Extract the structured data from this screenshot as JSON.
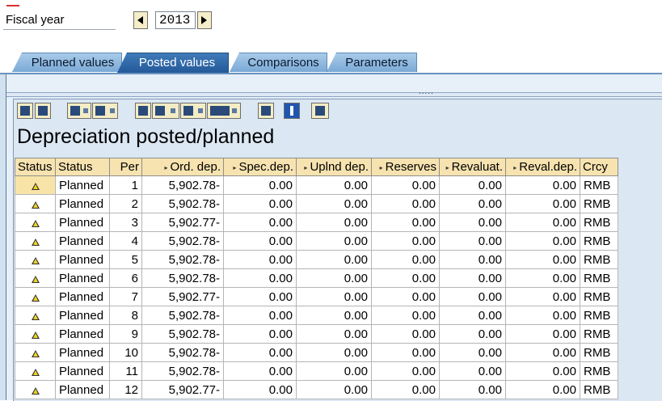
{
  "fiscal_year": {
    "label": "Fiscal year",
    "value": "2013"
  },
  "tabs": [
    {
      "label": "Planned values"
    },
    {
      "label": "Posted values"
    },
    {
      "label": "Comparisons"
    },
    {
      "label": "Parameters"
    }
  ],
  "report": {
    "title": "Depreciation posted/planned",
    "columns": [
      "Status",
      "Status",
      "Per",
      "Ord. dep.",
      "Spec.dep.",
      "Uplnd dep.",
      "Reserves",
      "Revaluat.",
      "Reval.dep.",
      "Crcy"
    ],
    "rows": [
      {
        "status_text": "Planned",
        "per": "1",
        "ord": "5,902.78-",
        "spec": "0.00",
        "uplnd": "0.00",
        "reserves": "0.00",
        "revaluat": "0.00",
        "revaldep": "0.00",
        "crcy": "RMB"
      },
      {
        "status_text": "Planned",
        "per": "2",
        "ord": "5,902.78-",
        "spec": "0.00",
        "uplnd": "0.00",
        "reserves": "0.00",
        "revaluat": "0.00",
        "revaldep": "0.00",
        "crcy": "RMB"
      },
      {
        "status_text": "Planned",
        "per": "3",
        "ord": "5,902.77-",
        "spec": "0.00",
        "uplnd": "0.00",
        "reserves": "0.00",
        "revaluat": "0.00",
        "revaldep": "0.00",
        "crcy": "RMB"
      },
      {
        "status_text": "Planned",
        "per": "4",
        "ord": "5,902.78-",
        "spec": "0.00",
        "uplnd": "0.00",
        "reserves": "0.00",
        "revaluat": "0.00",
        "revaldep": "0.00",
        "crcy": "RMB"
      },
      {
        "status_text": "Planned",
        "per": "5",
        "ord": "5,902.78-",
        "spec": "0.00",
        "uplnd": "0.00",
        "reserves": "0.00",
        "revaluat": "0.00",
        "revaldep": "0.00",
        "crcy": "RMB"
      },
      {
        "status_text": "Planned",
        "per": "6",
        "ord": "5,902.78-",
        "spec": "0.00",
        "uplnd": "0.00",
        "reserves": "0.00",
        "revaluat": "0.00",
        "revaldep": "0.00",
        "crcy": "RMB"
      },
      {
        "status_text": "Planned",
        "per": "7",
        "ord": "5,902.77-",
        "spec": "0.00",
        "uplnd": "0.00",
        "reserves": "0.00",
        "revaluat": "0.00",
        "revaldep": "0.00",
        "crcy": "RMB"
      },
      {
        "status_text": "Planned",
        "per": "8",
        "ord": "5,902.78-",
        "spec": "0.00",
        "uplnd": "0.00",
        "reserves": "0.00",
        "revaluat": "0.00",
        "revaldep": "0.00",
        "crcy": "RMB"
      },
      {
        "status_text": "Planned",
        "per": "9",
        "ord": "5,902.78-",
        "spec": "0.00",
        "uplnd": "0.00",
        "reserves": "0.00",
        "revaluat": "0.00",
        "revaldep": "0.00",
        "crcy": "RMB"
      },
      {
        "status_text": "Planned",
        "per": "10",
        "ord": "5,902.78-",
        "spec": "0.00",
        "uplnd": "0.00",
        "reserves": "0.00",
        "revaluat": "0.00",
        "revaldep": "0.00",
        "crcy": "RMB"
      },
      {
        "status_text": "Planned",
        "per": "11",
        "ord": "5,902.78-",
        "spec": "0.00",
        "uplnd": "0.00",
        "reserves": "0.00",
        "revaluat": "0.00",
        "revaldep": "0.00",
        "crcy": "RMB"
      },
      {
        "status_text": "Planned",
        "per": "12",
        "ord": "5,902.77-",
        "spec": "0.00",
        "uplnd": "0.00",
        "reserves": "0.00",
        "revaluat": "0.00",
        "revaldep": "0.00",
        "crcy": "RMB"
      }
    ]
  }
}
